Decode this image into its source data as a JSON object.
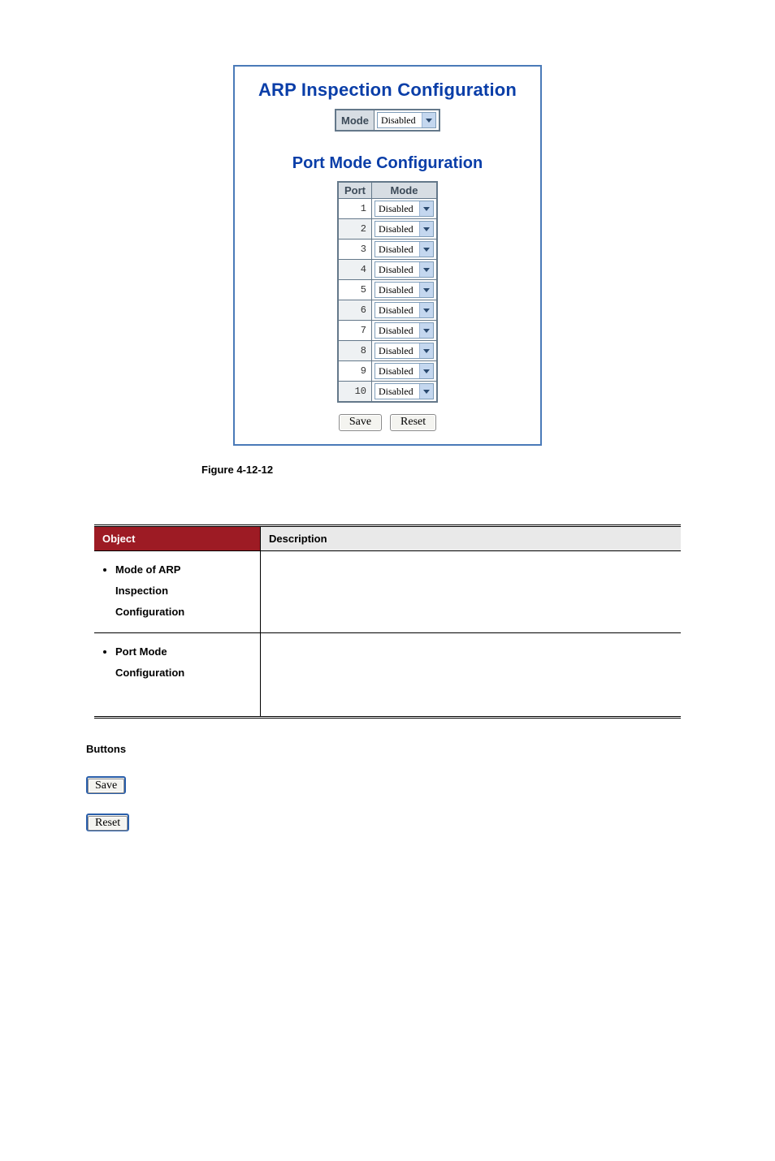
{
  "panel": {
    "title_main": "ARP Inspection Configuration",
    "title_sub": "Port Mode Configuration",
    "global_mode": {
      "label": "Mode",
      "value": "Disabled"
    },
    "port_table": {
      "headers": {
        "port": "Port",
        "mode": "Mode"
      },
      "rows": [
        {
          "port": "1",
          "mode": "Disabled"
        },
        {
          "port": "2",
          "mode": "Disabled"
        },
        {
          "port": "3",
          "mode": "Disabled"
        },
        {
          "port": "4",
          "mode": "Disabled"
        },
        {
          "port": "5",
          "mode": "Disabled"
        },
        {
          "port": "6",
          "mode": "Disabled"
        },
        {
          "port": "7",
          "mode": "Disabled"
        },
        {
          "port": "8",
          "mode": "Disabled"
        },
        {
          "port": "9",
          "mode": "Disabled"
        },
        {
          "port": "10",
          "mode": "Disabled"
        }
      ]
    },
    "buttons": {
      "save": "Save",
      "reset": "Reset"
    }
  },
  "figure_caption": "Figure 4-12-12",
  "desc_table": {
    "headers": {
      "object": "Object",
      "description": "Description"
    },
    "rows": [
      {
        "object_lines": [
          "Mode of ARP",
          "Inspection",
          "Configuration"
        ],
        "description": ""
      },
      {
        "object_lines": [
          "Port Mode",
          "Configuration"
        ],
        "description": ""
      }
    ]
  },
  "buttons_section": {
    "heading": "Buttons",
    "save": "Save",
    "reset": "Reset"
  }
}
